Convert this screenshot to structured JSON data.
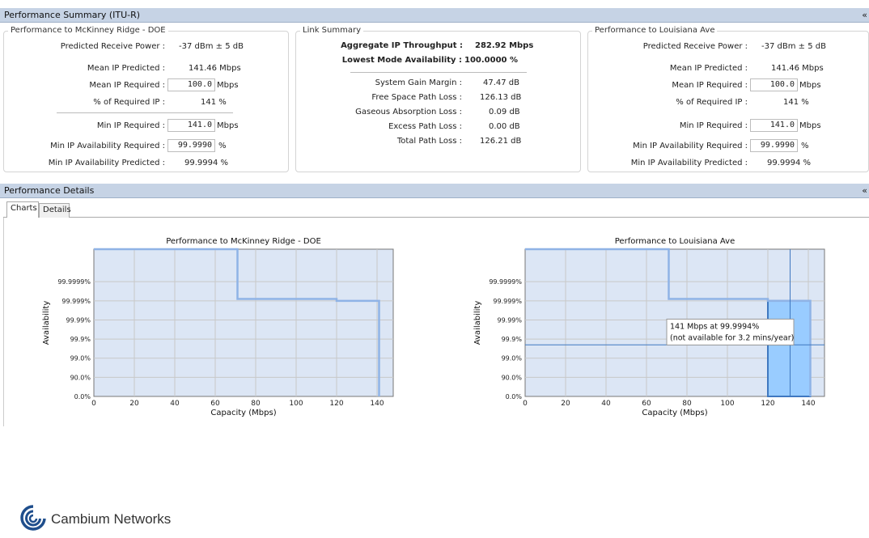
{
  "summary": {
    "header": "Performance Summary (ITU-R)",
    "collapse_glyph": "«",
    "left": {
      "title": "Performance to McKinney Ridge - DOE",
      "predicted_receive_power_label": "Predicted Receive Power :",
      "predicted_receive_power_value": "-37 dBm ± 5 dB",
      "mean_ip_predicted_label": "Mean IP Predicted :",
      "mean_ip_predicted_value": "141.46 Mbps",
      "mean_ip_required_label": "Mean IP Required :",
      "mean_ip_required_value": "100.0",
      "mean_ip_required_unit": "Mbps",
      "pct_required_label": "% of Required IP :",
      "pct_required_value": "141 %",
      "min_ip_required_label": "Min IP Required :",
      "min_ip_required_value": "141.0",
      "min_ip_required_unit": "Mbps",
      "min_avail_required_label": "Min IP Availability Required :",
      "min_avail_required_value": "99.9990",
      "min_avail_required_unit": "%",
      "min_avail_predicted_label": "Min IP Availability Predicted :",
      "min_avail_predicted_value": "99.9994 %"
    },
    "link": {
      "title": "Link Summary",
      "aggregate_label": "Aggregate IP Throughput :",
      "aggregate_value": "282.92 Mbps",
      "lowest_mode_label": "Lowest Mode Availability :",
      "lowest_mode_value": "100.0000 %",
      "rows": [
        {
          "label": "System Gain Margin :",
          "value": "47.47 dB"
        },
        {
          "label": "Free Space Path Loss :",
          "value": "126.13 dB"
        },
        {
          "label": "Gaseous Absorption Loss :",
          "value": "0.09 dB"
        },
        {
          "label": "Excess Path Loss :",
          "value": "0.00 dB"
        },
        {
          "label": "Total Path Loss :",
          "value": "126.21 dB"
        }
      ]
    },
    "right": {
      "title": "Performance to Louisiana Ave",
      "predicted_receive_power_label": "Predicted Receive Power :",
      "predicted_receive_power_value": "-37 dBm ± 5 dB",
      "mean_ip_predicted_label": "Mean IP Predicted :",
      "mean_ip_predicted_value": "141.46 Mbps",
      "mean_ip_required_label": "Mean IP Required :",
      "mean_ip_required_value": "100.0",
      "mean_ip_required_unit": "Mbps",
      "pct_required_label": "% of Required IP :",
      "pct_required_value": "141 %",
      "min_ip_required_label": "Min IP Required :",
      "min_ip_required_value": "141.0",
      "min_ip_required_unit": "Mbps",
      "min_avail_required_label": "Min IP Availability Required :",
      "min_avail_required_value": "99.9990",
      "min_avail_required_unit": "%",
      "min_avail_predicted_label": "Min IP Availability Predicted :",
      "min_avail_predicted_value": "99.9994 %"
    }
  },
  "details": {
    "header": "Performance Details",
    "collapse_glyph": "«",
    "tabs": [
      {
        "label": "Charts",
        "active": true
      },
      {
        "label": "Details",
        "active": false
      }
    ]
  },
  "colors": {
    "header_bg": "#c6d3e5",
    "plot_fill": "#dce6f5",
    "curve": "#8fb3e6",
    "highlight_fill": "#99ccff",
    "highlight_stroke": "#3f78c0",
    "grid": "#c8c8c8"
  },
  "logo": {
    "text": "Cambium Networks",
    "icon": "cambium-swirl-icon"
  },
  "chart_data": [
    {
      "type": "line",
      "title": "Performance to McKinney Ridge - DOE",
      "xlabel": "Capacity (Mbps)",
      "ylabel": "Availability",
      "xlim": [
        0,
        148
      ],
      "x_ticks": [
        0,
        20,
        40,
        60,
        80,
        100,
        120,
        140
      ],
      "y_ticks": [
        "0.0%",
        "90.0%",
        "99.0%",
        "99.9%",
        "99.99%",
        "99.999%",
        "99.9999%"
      ],
      "y_scale": "log-unavailability",
      "grid": true,
      "series": [
        {
          "x": [
            0,
            71,
            71,
            120,
            120,
            141,
            141
          ],
          "y": [
            "100%",
            "100%",
            "99.9992%",
            "99.9992%",
            "99.999%",
            "99.999%",
            "0.0%"
          ]
        }
      ]
    },
    {
      "type": "line",
      "title": "Performance to Louisiana Ave",
      "xlabel": "Capacity (Mbps)",
      "ylabel": "Availability",
      "xlim": [
        0,
        148
      ],
      "x_ticks": [
        0,
        20,
        40,
        60,
        80,
        100,
        120,
        140
      ],
      "y_ticks": [
        "0.0%",
        "90.0%",
        "99.0%",
        "99.9%",
        "99.99%",
        "99.999%",
        "99.9999%"
      ],
      "y_scale": "log-unavailability",
      "grid": true,
      "series": [
        {
          "x": [
            0,
            71,
            71,
            120,
            120,
            141,
            141
          ],
          "y": [
            "100%",
            "100%",
            "99.9992%",
            "99.9992%",
            "99.999%",
            "99.999%",
            "0.0%"
          ]
        }
      ],
      "highlight": {
        "x_from": 120,
        "x_to": 141,
        "y_top": "99.999%"
      },
      "crosshair": {
        "x": 131,
        "y": "99.8%"
      },
      "tooltip": [
        "141 Mbps at 99.9994%",
        "(not available for 3.2 mins/year)"
      ]
    }
  ]
}
